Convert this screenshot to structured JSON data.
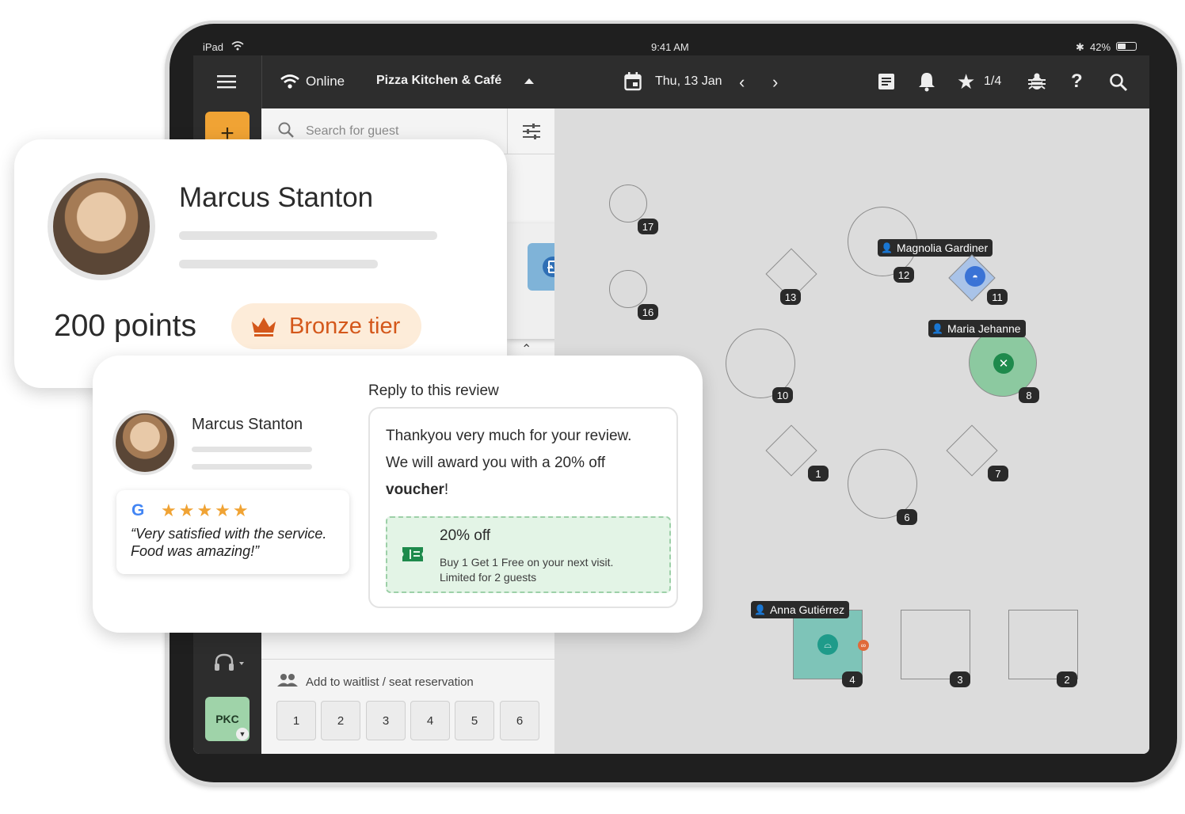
{
  "statusbar": {
    "device": "iPad",
    "time": "9:41 AM",
    "battery": "42%"
  },
  "topbar": {
    "status": "Online",
    "restaurant": "Pizza Kitchen & Café",
    "date": "Thu, 13 Jan",
    "favorites_count": "1/4"
  },
  "search": {
    "placeholder": "Search for guest"
  },
  "rail": {
    "add_label": "+",
    "location_badge": "PKC"
  },
  "waitlist": {
    "label": "Add to waitlist / seat reservation",
    "slots": [
      "1",
      "2",
      "3",
      "4",
      "5",
      "6"
    ]
  },
  "floor": {
    "tables": [
      "17",
      "16",
      "13",
      "12",
      "11",
      "10",
      "8",
      "1",
      "7",
      "6",
      "4",
      "3",
      "2"
    ],
    "guests": {
      "t12": "Magnolia Gardiner",
      "t8": "Maria Jehanne",
      "t4": "Anna Gutiérrez"
    }
  },
  "loyalty_card": {
    "name": "Marcus Stanton",
    "points": "200 points",
    "tier": "Bronze tier",
    "tier_color": "#d4581b"
  },
  "review_card": {
    "reviewer": "Marcus Stanton",
    "stars": "★★★★★",
    "review_text": "“Very satisfied with the service. Food was amazing!”",
    "reply_heading": "Reply to this review",
    "reply_line1": "Thankyou very much for your review.",
    "reply_line2": "We will award you with a 20% off",
    "reply_bold": "voucher",
    "reply_end": "!",
    "voucher_title": "20% off",
    "voucher_line1": "Buy 1 Get 1 Free on your next visit.",
    "voucher_line2": "Limited for 2 guests"
  },
  "colors": {
    "accent_green": "#8cc9a0",
    "teal": "#7ec4b8",
    "blue": "#3a73d6",
    "orange": "#f0a334"
  }
}
